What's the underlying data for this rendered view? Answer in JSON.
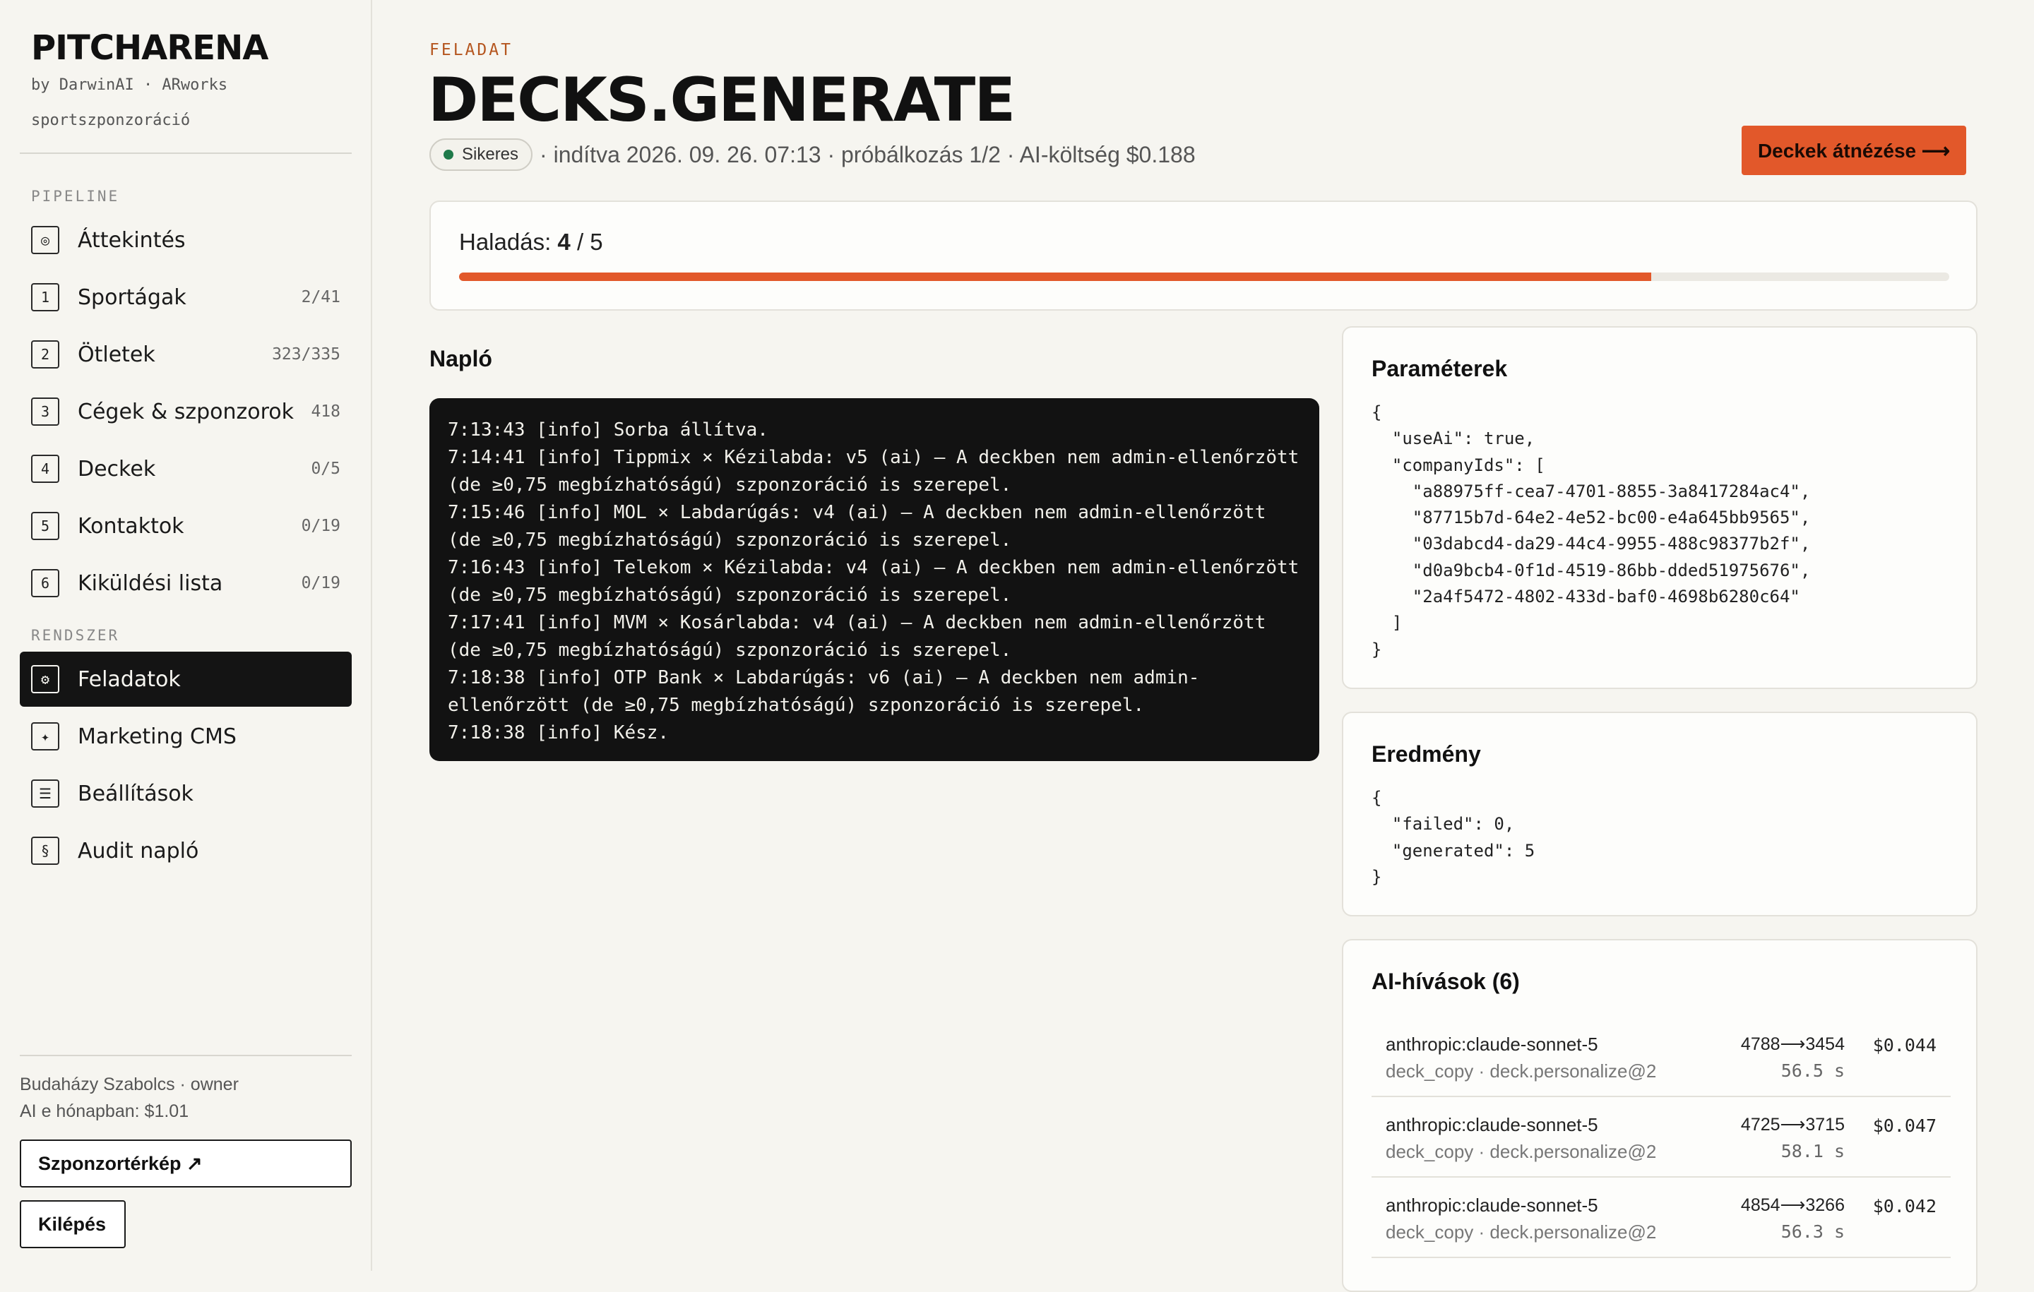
{
  "sidebar": {
    "brand": "PITCHARENA",
    "brand_sub": "by DarwinAI · ARworks",
    "brand_tag": "sportszponzoráció",
    "pipeline_label": "PIPELINE",
    "system_label": "RENDSZER",
    "pipeline_items": [
      {
        "icon": "◎",
        "label": "Áttekintés",
        "count": ""
      },
      {
        "icon": "1",
        "label": "Sportágak",
        "count": "2/41"
      },
      {
        "icon": "2",
        "label": "Ötletek",
        "count": "323/335"
      },
      {
        "icon": "3",
        "label": "Cégek & szponzorok",
        "count": "418"
      },
      {
        "icon": "4",
        "label": "Deckek",
        "count": "0/5"
      },
      {
        "icon": "5",
        "label": "Kontaktok",
        "count": "0/19"
      },
      {
        "icon": "6",
        "label": "Kiküldési lista",
        "count": "0/19"
      }
    ],
    "system_items": [
      {
        "icon": "⚙",
        "label": "Feladatok"
      },
      {
        "icon": "✦",
        "label": "Marketing CMS"
      },
      {
        "icon": "☰",
        "label": "Beállítások"
      },
      {
        "icon": "§",
        "label": "Audit napló"
      }
    ],
    "user": "Budaházy Szabolcs · owner",
    "ai_month": "AI e hónapban: $1.01",
    "sponsor_map_button": "Szponzortérkép ↗",
    "logout_button": "Kilépés"
  },
  "header": {
    "kicker": "FELADAT",
    "title": "DECKS.GENERATE",
    "status": "Sikeres",
    "meta": "· indítva 2026. 09. 26. 07:13 · próbálkozás 1/2 · AI-költség $0.188",
    "cta": "Deckek átnézése ⟶"
  },
  "progress": {
    "label": "Haladás:",
    "done": "4",
    "sep": "/",
    "total": "5",
    "fraction": 0.8
  },
  "log": {
    "title": "Napló",
    "lines": [
      "7:13:43 [info] Sorba állítva.",
      "7:14:41 [info] Tippmix × Kézilabda: v5 (ai) — A deckben nem admin-ellenőrzött (de ≥0,75 megbízhatóságú) szponzoráció is szerepel.",
      "7:15:46 [info] MOL × Labdarúgás: v4 (ai) — A deckben nem admin-ellenőrzött (de ≥0,75 megbízhatóságú) szponzoráció is szerepel.",
      "7:16:43 [info] Telekom × Kézilabda: v4 (ai) — A deckben nem admin-ellenőrzött (de ≥0,75 megbízhatóságú) szponzoráció is szerepel.",
      "7:17:41 [info] MVM × Kosárlabda: v4 (ai) — A deckben nem admin-ellenőrzött (de ≥0,75 megbízhatóságú) szponzoráció is szerepel.",
      "7:18:38 [info] OTP Bank × Labdarúgás: v6 (ai) — A deckben nem admin-ellenőrzött (de ≥0,75 megbízhatóságú) szponzoráció is szerepel.",
      "7:18:38 [info] Kész."
    ]
  },
  "params": {
    "title": "Paraméterek",
    "json": "{\n  \"useAi\": true,\n  \"companyIds\": [\n    \"a88975ff-cea7-4701-8855-3a8417284ac4\",\n    \"87715b7d-64e2-4e52-bc00-e4a645bb9565\",\n    \"03dabcd4-da29-44c4-9955-488c98377b2f\",\n    \"d0a9bcb4-0f1d-4519-86bb-dded51975676\",\n    \"2a4f5472-4802-433d-baf0-4698b6280c64\"\n  ]\n}"
  },
  "result": {
    "title": "Eredmény",
    "json": "{\n  \"failed\": 0,\n  \"generated\": 5\n}"
  },
  "ai_calls": {
    "title": "AI-hívások (6)",
    "items": [
      {
        "model": "anthropic:claude-sonnet-5",
        "sub": "deck_copy · deck.personalize@2",
        "tokens": "4788⟶3454",
        "duration": "56.5 s",
        "cost": "$0.044"
      },
      {
        "model": "anthropic:claude-sonnet-5",
        "sub": "deck_copy · deck.personalize@2",
        "tokens": "4725⟶3715",
        "duration": "58.1 s",
        "cost": "$0.047"
      },
      {
        "model": "anthropic:claude-sonnet-5",
        "sub": "deck_copy · deck.personalize@2",
        "tokens": "4854⟶3266",
        "duration": "56.3 s",
        "cost": "$0.042"
      }
    ]
  },
  "colors": {
    "accent": "#e2582a",
    "success": "#1f7a4a",
    "dark": "#121212"
  }
}
